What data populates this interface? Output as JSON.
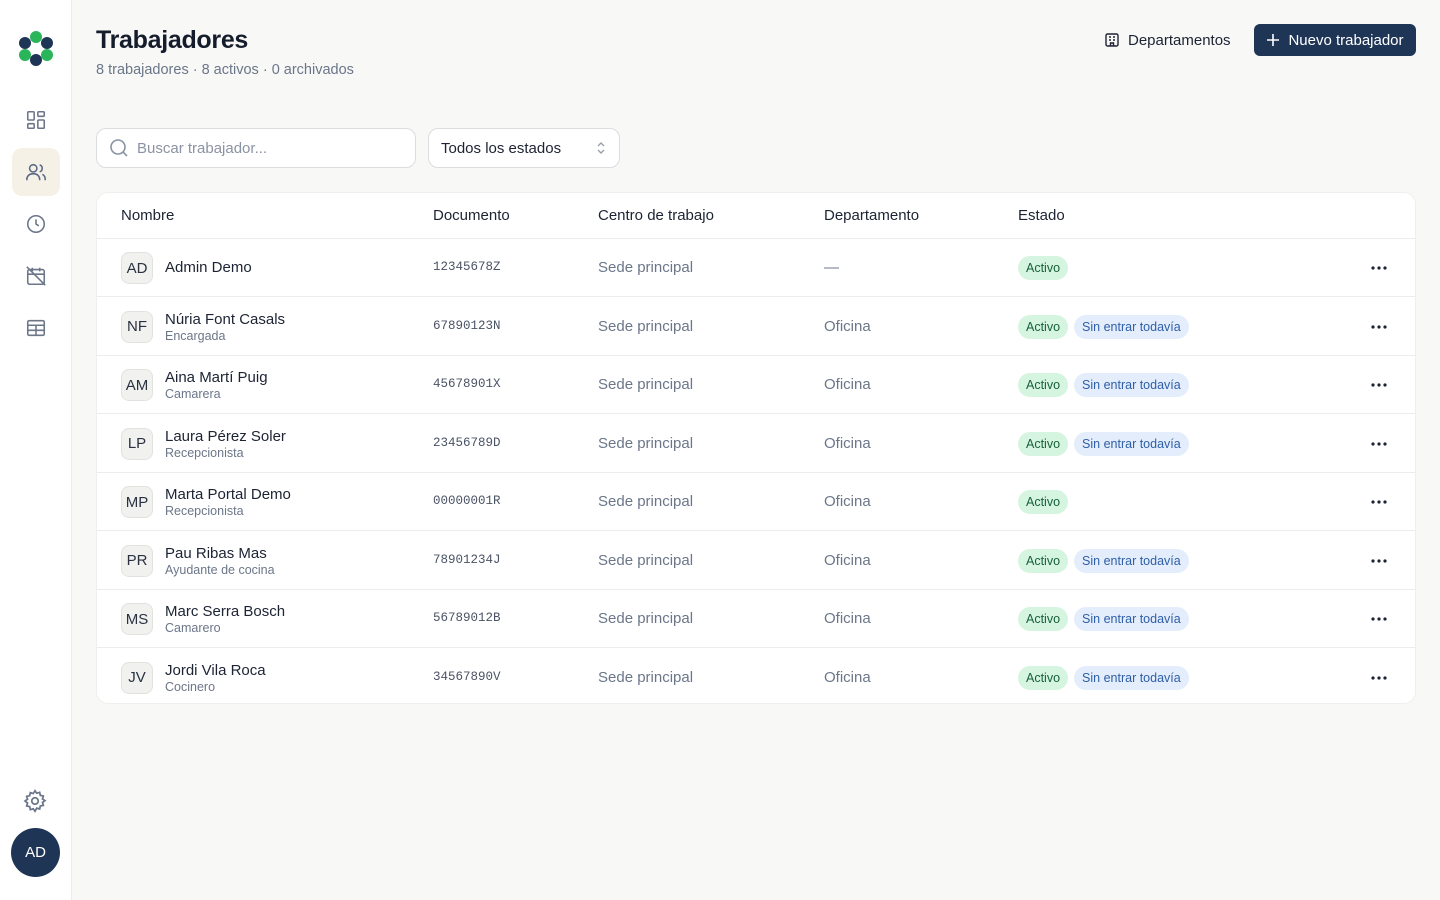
{
  "colors": {
    "accent": "#1f3556",
    "active_badge_bg": "#d6f5e0",
    "info_badge_bg": "#e4edfb",
    "logo_green": "#2bb55a",
    "logo_navy": "#1f3556"
  },
  "sidebar": {
    "items": [
      {
        "icon": "dashboard-icon",
        "active": false
      },
      {
        "icon": "users-icon",
        "active": true
      },
      {
        "icon": "clock-icon",
        "active": false
      },
      {
        "icon": "calendar-off-icon",
        "active": false
      },
      {
        "icon": "table-icon",
        "active": false
      }
    ],
    "settings_icon": "gear-icon",
    "user_initials": "AD"
  },
  "header": {
    "title": "Trabajadores",
    "subtitle": "8 trabajadores · 8 activos · 0 archivados",
    "departments_label": "Departamentos",
    "new_label": "Nuevo trabajador"
  },
  "filters": {
    "search_placeholder": "Buscar trabajador...",
    "search_value": "",
    "status_selected": "Todos los estados"
  },
  "table": {
    "columns": [
      "Nombre",
      "Documento",
      "Centro de trabajo",
      "Departamento",
      "Estado"
    ],
    "rows": [
      {
        "initials": "AD",
        "name": "Admin Demo",
        "role": "",
        "document": "12345678Z",
        "center": "Sede principal",
        "department": "—",
        "status": "Activo",
        "extra": ""
      },
      {
        "initials": "NF",
        "name": "Núria Font Casals",
        "role": "Encargada",
        "document": "67890123N",
        "center": "Sede principal",
        "department": "Oficina",
        "status": "Activo",
        "extra": "Sin entrar todavía"
      },
      {
        "initials": "AM",
        "name": "Aina Martí Puig",
        "role": "Camarera",
        "document": "45678901X",
        "center": "Sede principal",
        "department": "Oficina",
        "status": "Activo",
        "extra": "Sin entrar todavía"
      },
      {
        "initials": "LP",
        "name": "Laura Pérez Soler",
        "role": "Recepcionista",
        "document": "23456789D",
        "center": "Sede principal",
        "department": "Oficina",
        "status": "Activo",
        "extra": "Sin entrar todavía"
      },
      {
        "initials": "MP",
        "name": "Marta Portal Demo",
        "role": "Recepcionista",
        "document": "00000001R",
        "center": "Sede principal",
        "department": "Oficina",
        "status": "Activo",
        "extra": ""
      },
      {
        "initials": "PR",
        "name": "Pau Ribas Mas",
        "role": "Ayudante de cocina",
        "document": "78901234J",
        "center": "Sede principal",
        "department": "Oficina",
        "status": "Activo",
        "extra": "Sin entrar todavía"
      },
      {
        "initials": "MS",
        "name": "Marc Serra Bosch",
        "role": "Camarero",
        "document": "56789012B",
        "center": "Sede principal",
        "department": "Oficina",
        "status": "Activo",
        "extra": "Sin entrar todavía"
      },
      {
        "initials": "JV",
        "name": "Jordi Vila Roca",
        "role": "Cocinero",
        "document": "34567890V",
        "center": "Sede principal",
        "department": "Oficina",
        "status": "Activo",
        "extra": "Sin entrar todavía"
      }
    ]
  }
}
